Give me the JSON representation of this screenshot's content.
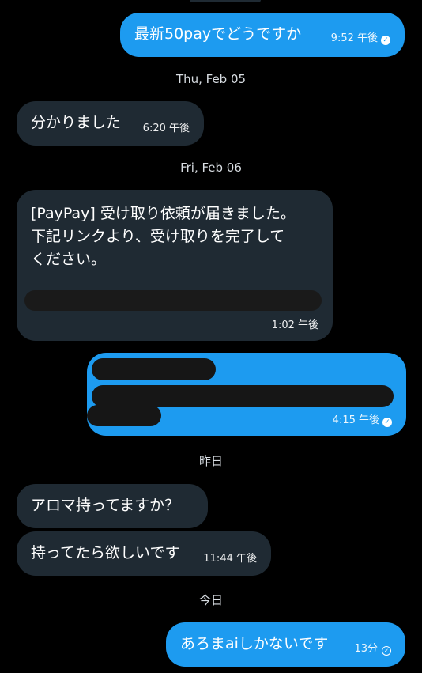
{
  "conversation": {
    "messages": [
      {
        "direction": "outgoing",
        "text": "最新50payでどうですか",
        "time": "9:52 午後",
        "status": "read"
      },
      {
        "direction": "incoming",
        "text": "分かりました",
        "time": "6:20 午後"
      },
      {
        "direction": "incoming",
        "text": "[PayPay] 受け取り依頼が届きました。\n下記リンクより、受け取りを完了して\nください。",
        "time": "1:02 午後"
      },
      {
        "direction": "outgoing",
        "text": "",
        "time": "4:15 午後",
        "status": "read"
      },
      {
        "direction": "incoming",
        "text": "アロマ持ってますか？",
        "time": ""
      },
      {
        "direction": "incoming",
        "text": "持ってたら欲しいです",
        "time": "11:44 午後"
      },
      {
        "direction": "outgoing",
        "text": "あろまaiしかないです",
        "time": "13分",
        "status": "sent"
      }
    ],
    "date_separators": [
      "Thu, Feb 05",
      "Fri, Feb 06",
      "昨日",
      "今日"
    ]
  },
  "colors": {
    "background": "#000000",
    "incoming_bubble": "#1f2a33",
    "outgoing_bubble": "#1d9bf0"
  },
  "icons": {
    "read": "check-circle-filled-icon",
    "sent": "check-circle-outline-icon"
  }
}
